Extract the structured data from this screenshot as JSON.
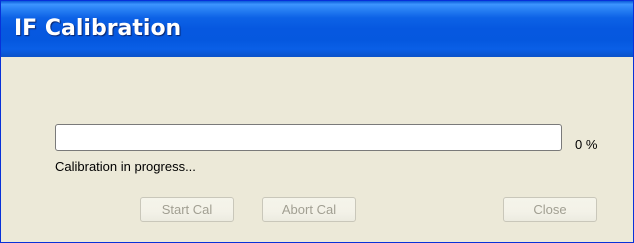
{
  "window": {
    "title": "IF Calibration"
  },
  "progress": {
    "value_percent": 0,
    "label": "0 %"
  },
  "status": {
    "text": "Calibration in progress..."
  },
  "buttons": {
    "start_label": "Start Cal",
    "abort_label": "Abort Cal",
    "close_label": "Close"
  },
  "colors": {
    "titlebar": "#0558df",
    "window_background": "#ece9d8",
    "disabled_text": "#a19f92",
    "progress_fill": "#2ecb2e"
  }
}
